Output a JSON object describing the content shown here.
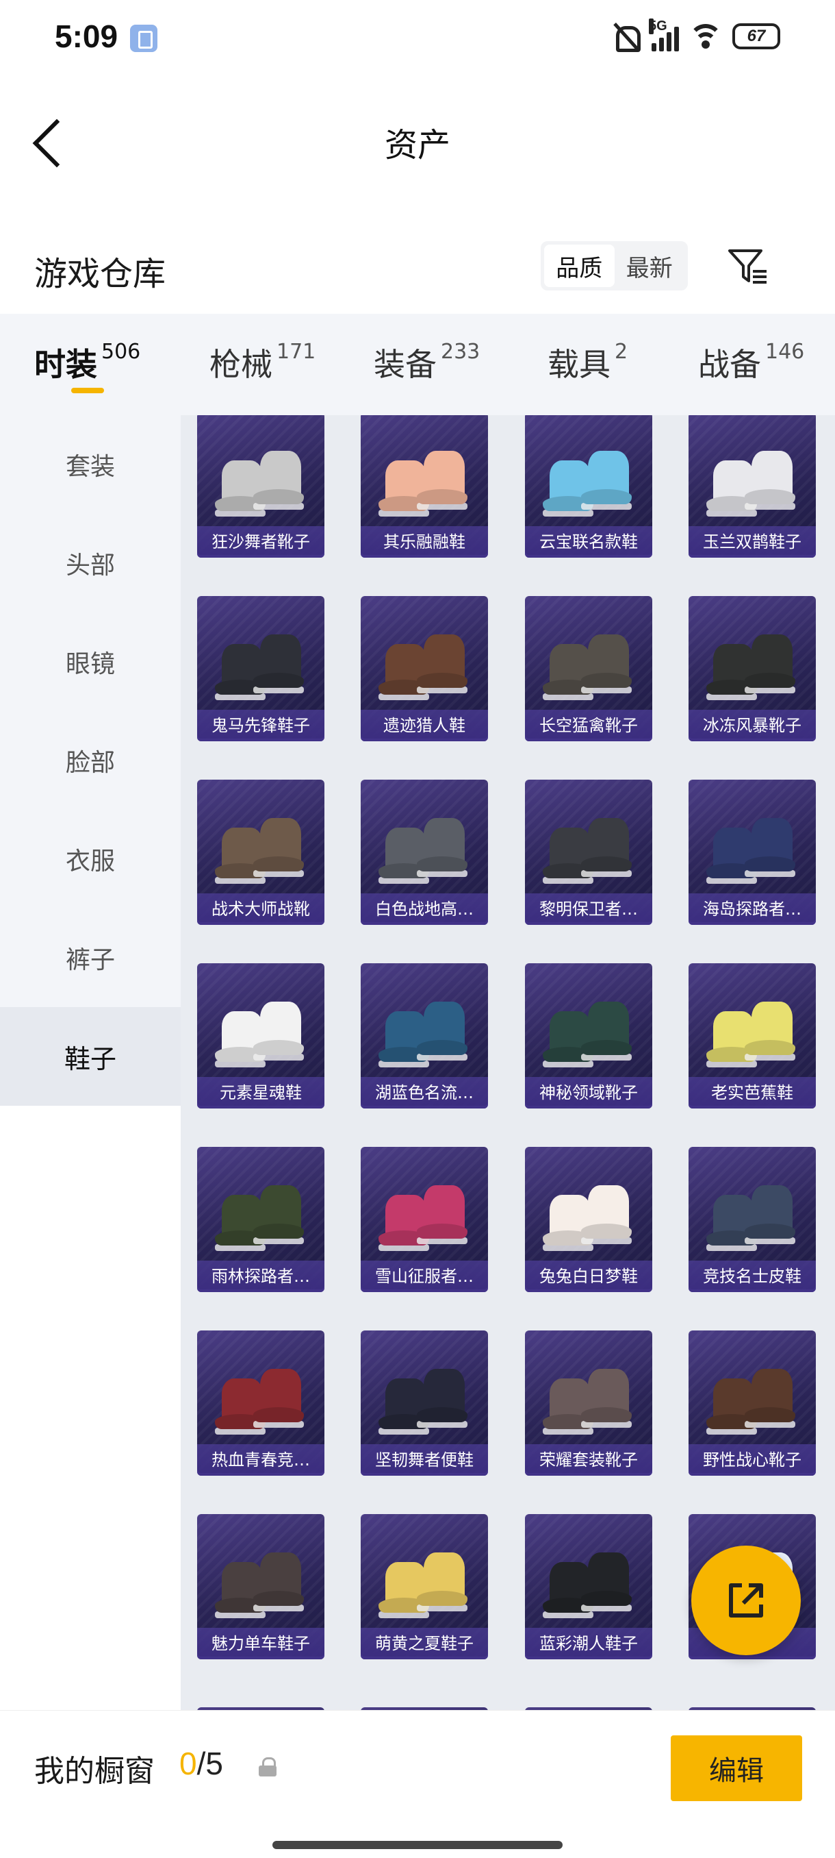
{
  "status_bar": {
    "time": "5:09",
    "network": "5G",
    "battery": "67"
  },
  "header": {
    "title": "资产"
  },
  "warehouse": {
    "title": "游戏仓库",
    "sort_options": [
      "品质",
      "最新"
    ],
    "active_sort": "品质"
  },
  "category_tabs": [
    {
      "name": "时装",
      "count": "506",
      "active": true
    },
    {
      "name": "枪械",
      "count": "171",
      "active": false
    },
    {
      "name": "装备",
      "count": "233",
      "active": false
    },
    {
      "name": "载具",
      "count": "2",
      "active": false
    },
    {
      "name": "战备",
      "count": "146",
      "active": false
    }
  ],
  "sidebar": {
    "items": [
      "套装",
      "头部",
      "眼镜",
      "脸部",
      "衣服",
      "裤子",
      "鞋子"
    ],
    "active": "鞋子"
  },
  "items": [
    {
      "name": "狂沙舞者靴子",
      "color": "#c9c9c9"
    },
    {
      "name": "其乐融融鞋",
      "color": "#f0b49a"
    },
    {
      "name": "云宝联名款鞋",
      "color": "#6fc3e8"
    },
    {
      "name": "玉兰双鹊鞋子",
      "color": "#e8e8ec"
    },
    {
      "name": "鬼马先锋鞋子",
      "color": "#2e3038"
    },
    {
      "name": "遗迹猎人鞋",
      "color": "#6b4432"
    },
    {
      "name": "长空猛禽靴子",
      "color": "#55504a"
    },
    {
      "name": "冰冻风暴靴子",
      "color": "#303231"
    },
    {
      "name": "战术大师战靴",
      "color": "#6e5a4a"
    },
    {
      "name": "白色战地高…",
      "color": "#5a5e66"
    },
    {
      "name": "黎明保卫者…",
      "color": "#3a3c42"
    },
    {
      "name": "海岛探路者…",
      "color": "#2f3b6e"
    },
    {
      "name": "元素星魂鞋",
      "color": "#f2f2f2"
    },
    {
      "name": "湖蓝色名流…",
      "color": "#2c5f86"
    },
    {
      "name": "神秘领域靴子",
      "color": "#2c4a44"
    },
    {
      "name": "老实芭蕉鞋",
      "color": "#e8e070"
    },
    {
      "name": "雨林探路者…",
      "color": "#3c4a30"
    },
    {
      "name": "雪山征服者…",
      "color": "#c43a6a"
    },
    {
      "name": "兔兔白日梦鞋",
      "color": "#f6eee8"
    },
    {
      "name": "竞技名士皮鞋",
      "color": "#3c4a64"
    },
    {
      "name": "热血青春竞…",
      "color": "#8c2a30"
    },
    {
      "name": "坚韧舞者便鞋",
      "color": "#26283a"
    },
    {
      "name": "荣耀套装靴子",
      "color": "#6a5a5a"
    },
    {
      "name": "野性战心靴子",
      "color": "#5a3a2c"
    },
    {
      "name": "魅力单车鞋子",
      "color": "#4a4040"
    },
    {
      "name": "萌黄之夏鞋子",
      "color": "#e6c860"
    },
    {
      "name": "蓝彩潮人鞋子",
      "color": "#222428"
    },
    {
      "name": "子",
      "color": "#e8eef8"
    }
  ],
  "bottom_bar": {
    "showcase_label": "我的橱窗",
    "showcase_current": "0",
    "showcase_total": "/5",
    "edit_label": "编辑"
  }
}
